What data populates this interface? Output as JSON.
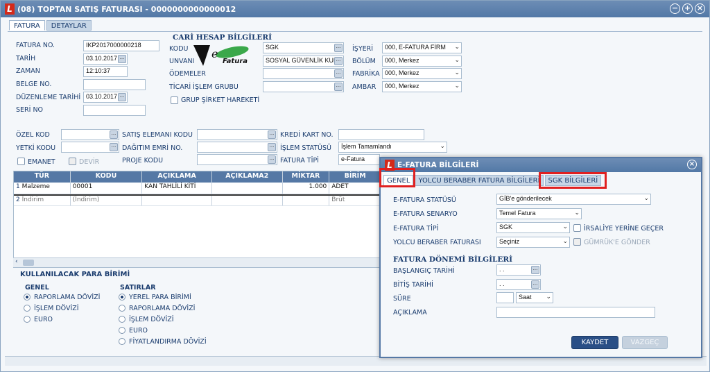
{
  "window": {
    "title": "(08) TOPTAN SATIŞ FATURASI - 0000000000000012"
  },
  "tabs": [
    "FATURA",
    "DETAYLAR"
  ],
  "left": {
    "fatura_no_label": "FATURA NO.",
    "fatura_no": "IKP2017000000218",
    "tarih_label": "TARİH",
    "tarih": "03.10.2017",
    "zaman_label": "ZAMAN",
    "zaman": "12:10:37",
    "belge_label": "BELGE NO.",
    "duzenleme_label": "DÜZENLEME TARİHİ",
    "duzenleme": "03.10.2017",
    "seri_label": "SERİ NO"
  },
  "cari": {
    "title": "CARİ HESAP BİLGİLERİ",
    "kodu_label": "KODU",
    "kodu": "SGK",
    "unvani_label": "UNVANI",
    "unvani": "SOSYAL GÜVENLİK KURU",
    "odemeler_label": "ÖDEMELER",
    "ticari_label": "TİCARİ İŞLEM GRUBU",
    "grup_label": "GRUP ŞİRKET HAREKETİ",
    "efatura_logo": "Fatura"
  },
  "right": {
    "isyeri_label": "İŞYERİ",
    "isyeri": "000, E-FATURA FİRM",
    "bolum_label": "BÖLÜM",
    "bolum": "000, Merkez",
    "fabrika_label": "FABRİKA",
    "fabrika": "000, Merkez",
    "ambar_label": "AMBAR",
    "ambar": "000, Merkez"
  },
  "middle": {
    "ozel_kod": "ÖZEL KOD",
    "yetki_kodu": "YETKİ KODU",
    "satis_elemani": "SATIŞ ELEMANI KODU",
    "dagitim": "DAĞITIM EMRİ NO.",
    "proje": "PROJE KODU",
    "kredi_karti": "KREDİ KART NO.",
    "islem_statusu": "İŞLEM STATÜSÜ",
    "islem_statusu_val": "İşlem Tamamlandı",
    "fatura_tipi": "FATURA TİPİ",
    "fatura_tipi_val": "e-Fatura",
    "emanet": "EMANET",
    "devir": "DEVİR"
  },
  "grid": {
    "headers": [
      "TÜR",
      "KODU",
      "AÇIKLAMA",
      "AÇIKLAMA2",
      "MİKTAR",
      "BİRİM"
    ],
    "rows": [
      [
        "Malzeme",
        "00001",
        "KAN TAHLİLİ KİTİ",
        "",
        "1.000",
        "ADET"
      ],
      [
        "İndirim",
        "(İndirim)",
        "",
        "",
        "",
        "Brüt"
      ]
    ]
  },
  "para": {
    "title": "KULLANILACAK PARA BİRİMİ",
    "genel_title": "GENEL",
    "genel": [
      "RAPORLAMA DÖVİZİ",
      "İŞLEM DÖVİZİ",
      "EURO"
    ],
    "satirlar_title": "SATIRLAR",
    "satirlar": [
      "YEREL PARA BİRİMİ",
      "RAPORLAMA DÖVİZİ",
      "İŞLEM DÖVİZİ",
      "EURO",
      "FİYATLANDIRMA DÖVİZİ"
    ]
  },
  "dialog": {
    "title": "E-FATURA BİLGİLERİ",
    "tabs": [
      "GENEL",
      "YOLCU BERABER FATURA BİLGİLERİ",
      "SGK BİLGİLERİ"
    ],
    "statu_label": "E-FATURA STATÜSÜ",
    "statu": "GİB'e gönderilecek",
    "senaryo_label": "E-FATURA SENARYO",
    "senaryo": "Temel Fatura",
    "tipi_label": "E-FATURA TİPİ",
    "tipi": "SGK",
    "irsaliye_label": "İRSALİYE YERİNE GEÇER",
    "yolcu_label": "YOLCU BERABER FATURASI",
    "yolcu": "Seçiniz",
    "gumruk_label": "GÜMRÜK'E GÖNDER",
    "donem_title": "FATURA DÖNEMİ BİLGİLERİ",
    "baslangic_label": "BAŞLANGIÇ TARİHİ",
    "baslangic": ". .",
    "bitis_label": "BİTİŞ TARİHİ",
    "bitis": ". .",
    "sure_label": "SÜRE",
    "sure_unit": "Saat",
    "aciklama_label": "AÇIKLAMA",
    "kaydet": "KAYDET",
    "vazgec": "VAZGEÇ"
  },
  "colors": {
    "accent": "#5578a5",
    "highlight": "#e02020"
  }
}
